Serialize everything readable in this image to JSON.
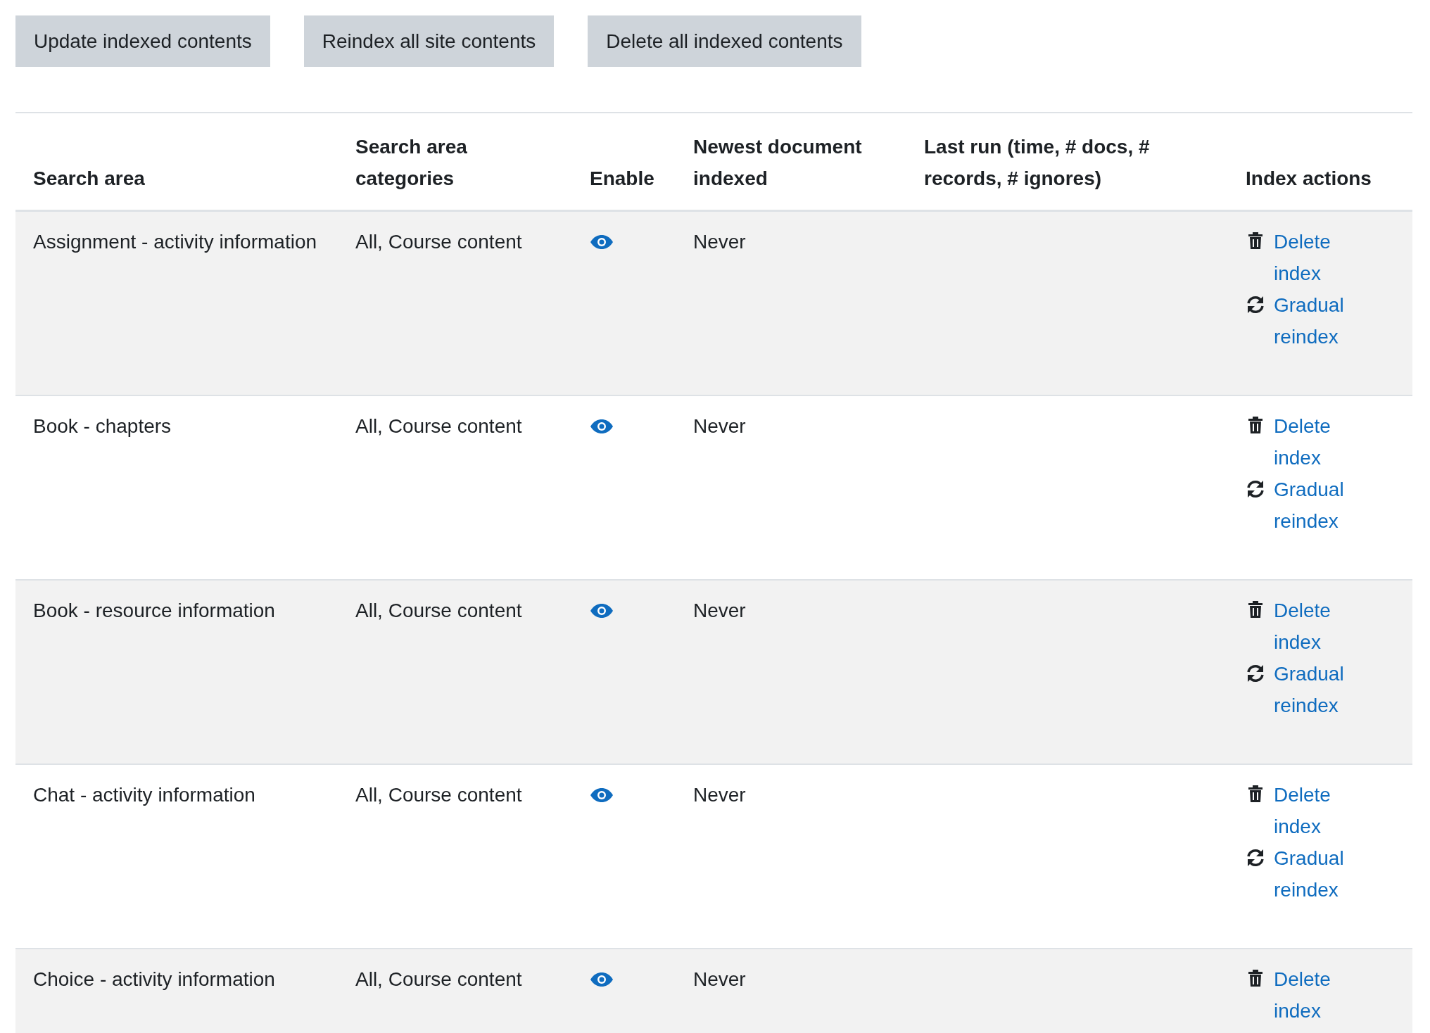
{
  "buttons": [
    "Update indexed contents",
    "Reindex all site contents",
    "Delete all indexed contents"
  ],
  "table": {
    "columns": [
      "Search area",
      "Search area categories",
      "Enable",
      "Newest document indexed",
      "Last run (time, # docs, # records, # ignores)",
      "Index actions"
    ],
    "rows": [
      {
        "area": "Assignment - activity information",
        "categories": "All, Course content",
        "enabled": true,
        "newest": "Never",
        "actions": [
          "Delete index",
          "Gradual reindex"
        ]
      },
      {
        "area": "Book - chapters",
        "categories": "All, Course content",
        "enabled": true,
        "newest": "Never",
        "actions": [
          "Delete index",
          "Gradual reindex"
        ]
      },
      {
        "area": "Book - resource information",
        "categories": "All, Course content",
        "enabled": true,
        "newest": "Never",
        "actions": [
          "Delete index",
          "Gradual reindex"
        ]
      },
      {
        "area": "Chat - activity information",
        "categories": "All, Course content",
        "enabled": true,
        "newest": "Never",
        "actions": [
          "Delete index",
          "Gradual reindex"
        ]
      },
      {
        "area": "Choice - activity information",
        "categories": "All, Course content",
        "enabled": true,
        "newest": "Never",
        "actions": [
          "Delete index"
        ]
      }
    ]
  }
}
